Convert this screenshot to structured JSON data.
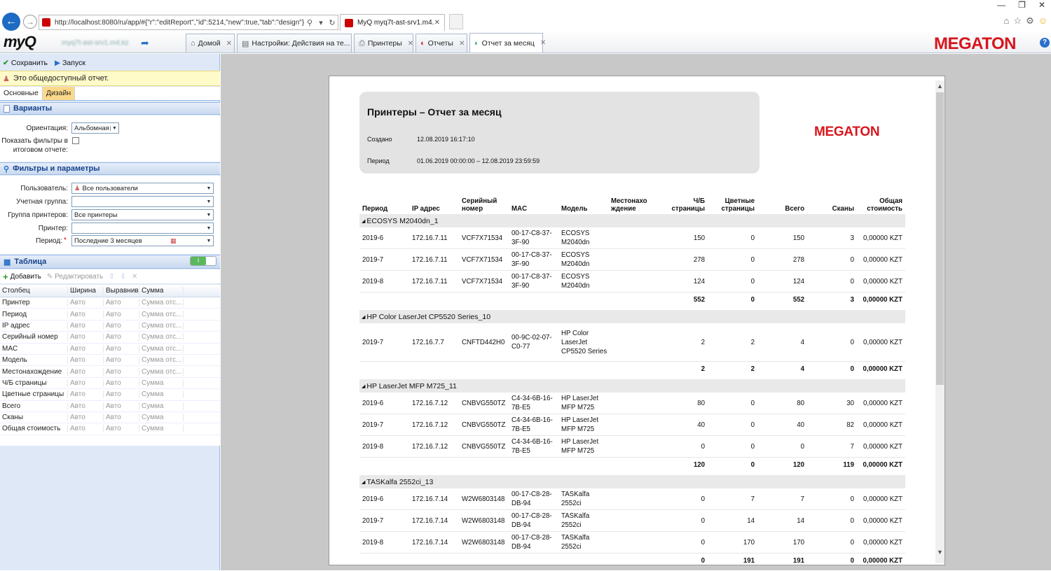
{
  "browser": {
    "url": "http://localhost:8080/ru/app/#{\"r\":\"editReport\",\"id\":5214,\"new\":true,\"tab\":\"design\"}",
    "tab_title": "MyQ myq7t-ast-srv1.m4.kz",
    "window_controls": [
      "—",
      "❐",
      "✕"
    ]
  },
  "app": {
    "logo_main": "myQ",
    "server": "myq7t-ast-srv1.m4.kz",
    "tabs": [
      {
        "label": "Домой",
        "icon": "home-icon",
        "closable": true
      },
      {
        "label": "Настройки: Действия на те...",
        "icon": "settings-icon",
        "closable": true
      },
      {
        "label": "Принтеры",
        "icon": "printer-icon",
        "closable": true
      },
      {
        "label": "Отчеты",
        "icon": "reports-icon",
        "closable": true
      },
      {
        "label": "Отчет за месяц",
        "icon": "report-icon",
        "closable": true,
        "active": true
      }
    ],
    "brand": "MEGATON",
    "brand_color": "#d8161d"
  },
  "left": {
    "toolbar": {
      "save": "Сохранить",
      "run": "Запуск"
    },
    "public_notice": "Это общедоступный отчет.",
    "subtabs": [
      "Основные",
      "Дизайн"
    ],
    "variants": {
      "title": "Варианты",
      "orientation_label": "Ориентация:",
      "orientation_value": "Альбомная",
      "show_filters_label_1": "Показать фильтры в",
      "show_filters_label_2": "итоговом отчете:"
    },
    "filters": {
      "title": "Фильтры и параметры",
      "user_label": "Пользователь:",
      "user_value": "Все пользователи",
      "account_label": "Учетная группа:",
      "account_value": "",
      "printer_group_label": "Группа принтеров:",
      "printer_group_value": "Все принтеры",
      "printer_label": "Принтер:",
      "printer_value": "",
      "period_label": "Период:",
      "period_required": "*",
      "period_value": "Последние 3 месяцев"
    },
    "table": {
      "title": "Таблица",
      "add": "Добавить",
      "edit": "Редактировать",
      "headers": [
        "Столбец",
        "Ширина",
        "Выравнива",
        "Сумма"
      ],
      "rows": [
        [
          "Принтер",
          "Авто",
          "Авто",
          "Сумма отс..."
        ],
        [
          "Период",
          "Авто",
          "Авто",
          "Сумма отс..."
        ],
        [
          "IP адрес",
          "Авто",
          "Авто",
          "Сумма отс..."
        ],
        [
          "Серийный номер",
          "Авто",
          "Авто",
          "Сумма отс..."
        ],
        [
          "MAC",
          "Авто",
          "Авто",
          "Сумма отс..."
        ],
        [
          "Модель",
          "Авто",
          "Авто",
          "Сумма отс..."
        ],
        [
          "Местонахождение",
          "Авто",
          "Авто",
          "Сумма отс..."
        ],
        [
          "Ч/Б страницы",
          "Авто",
          "Авто",
          "Сумма"
        ],
        [
          "Цветные страницы",
          "Авто",
          "Авто",
          "Сумма"
        ],
        [
          "Всего",
          "Авто",
          "Авто",
          "Сумма"
        ],
        [
          "Сканы",
          "Авто",
          "Авто",
          "Сумма"
        ],
        [
          "Общая стоимость",
          "Авто",
          "Авто",
          "Сумма"
        ]
      ]
    }
  },
  "report": {
    "title": "Принтеры – Отчет за месяц",
    "created_label": "Создано",
    "created_value": "12.08.2019 16:17:10",
    "period_label": "Период",
    "period_value": "01.06.2019 00:00:00 – 12.08.2019 23:59:59",
    "logo": "MEGATON",
    "headers": [
      [
        "Период"
      ],
      [
        "IP адрес"
      ],
      [
        "Серийный",
        "номер"
      ],
      [
        "MAC"
      ],
      [
        "Модель"
      ],
      [
        "Местонахо",
        "ждение"
      ],
      [
        "Ч/Б",
        "страницы"
      ],
      [
        "Цветные",
        "страницы"
      ],
      [
        "Всего"
      ],
      [
        "Сканы"
      ],
      [
        "Общая",
        "стоимость"
      ]
    ],
    "groups": [
      {
        "name": "ECOSYS M2040dn_1",
        "rows": [
          [
            "2019-6",
            "172.16.7.11",
            "VCF7X71534",
            "00-17-C8-37-3F-90",
            "ECOSYS M2040dn",
            "",
            "150",
            "0",
            "150",
            "3",
            "0,00000 KZT"
          ],
          [
            "2019-7",
            "172.16.7.11",
            "VCF7X71534",
            "00-17-C8-37-3F-90",
            "ECOSYS M2040dn",
            "",
            "278",
            "0",
            "278",
            "0",
            "0,00000 KZT"
          ],
          [
            "2019-8",
            "172.16.7.11",
            "VCF7X71534",
            "00-17-C8-37-3F-90",
            "ECOSYS M2040dn",
            "",
            "124",
            "0",
            "124",
            "0",
            "0,00000 KZT"
          ]
        ],
        "total": [
          "552",
          "0",
          "552",
          "3",
          "0,00000 KZT"
        ]
      },
      {
        "name": "HP Color LaserJet CP5520 Series_10",
        "rows": [
          [
            "2019-7",
            "172.16.7.7",
            "CNFTD442H0",
            "00-9C-02-07-C0-77",
            "HP Color LaserJet CP5520 Series",
            "",
            "2",
            "2",
            "4",
            "0",
            "0,00000 KZT"
          ]
        ],
        "total": [
          "2",
          "2",
          "4",
          "0",
          "0,00000 KZT"
        ]
      },
      {
        "name": "HP LaserJet MFP M725_11",
        "rows": [
          [
            "2019-6",
            "172.16.7.12",
            "CNBVG550TZ",
            "C4-34-6B-16-7B-E5",
            "HP LaserJet MFP M725",
            "",
            "80",
            "0",
            "80",
            "30",
            "0,00000 KZT"
          ],
          [
            "2019-7",
            "172.16.7.12",
            "CNBVG550TZ",
            "C4-34-6B-16-7B-E5",
            "HP LaserJet MFP M725",
            "",
            "40",
            "0",
            "40",
            "82",
            "0,00000 KZT"
          ],
          [
            "2019-8",
            "172.16.7.12",
            "CNBVG550TZ",
            "C4-34-6B-16-7B-E5",
            "HP LaserJet MFP M725",
            "",
            "0",
            "0",
            "0",
            "7",
            "0,00000 KZT"
          ]
        ],
        "total": [
          "120",
          "0",
          "120",
          "119",
          "0,00000 KZT"
        ]
      },
      {
        "name": "TASKalfa 2552ci_13",
        "rows": [
          [
            "2019-6",
            "172.16.7.14",
            "W2W6803148",
            "00-17-C8-28-DB-94",
            "TASKalfa 2552ci",
            "",
            "0",
            "7",
            "7",
            "0",
            "0,00000 KZT"
          ],
          [
            "2019-7",
            "172.16.7.14",
            "W2W6803148",
            "00-17-C8-28-DB-94",
            "TASKalfa 2552ci",
            "",
            "0",
            "14",
            "14",
            "0",
            "0,00000 KZT"
          ],
          [
            "2019-8",
            "172.16.7.14",
            "W2W6803148",
            "00-17-C8-28-DB-94",
            "TASKalfa 2552ci",
            "",
            "0",
            "170",
            "170",
            "0",
            "0,00000 KZT"
          ]
        ],
        "total": [
          "0",
          "191",
          "191",
          "0",
          "0,00000 KZT"
        ]
      }
    ]
  }
}
